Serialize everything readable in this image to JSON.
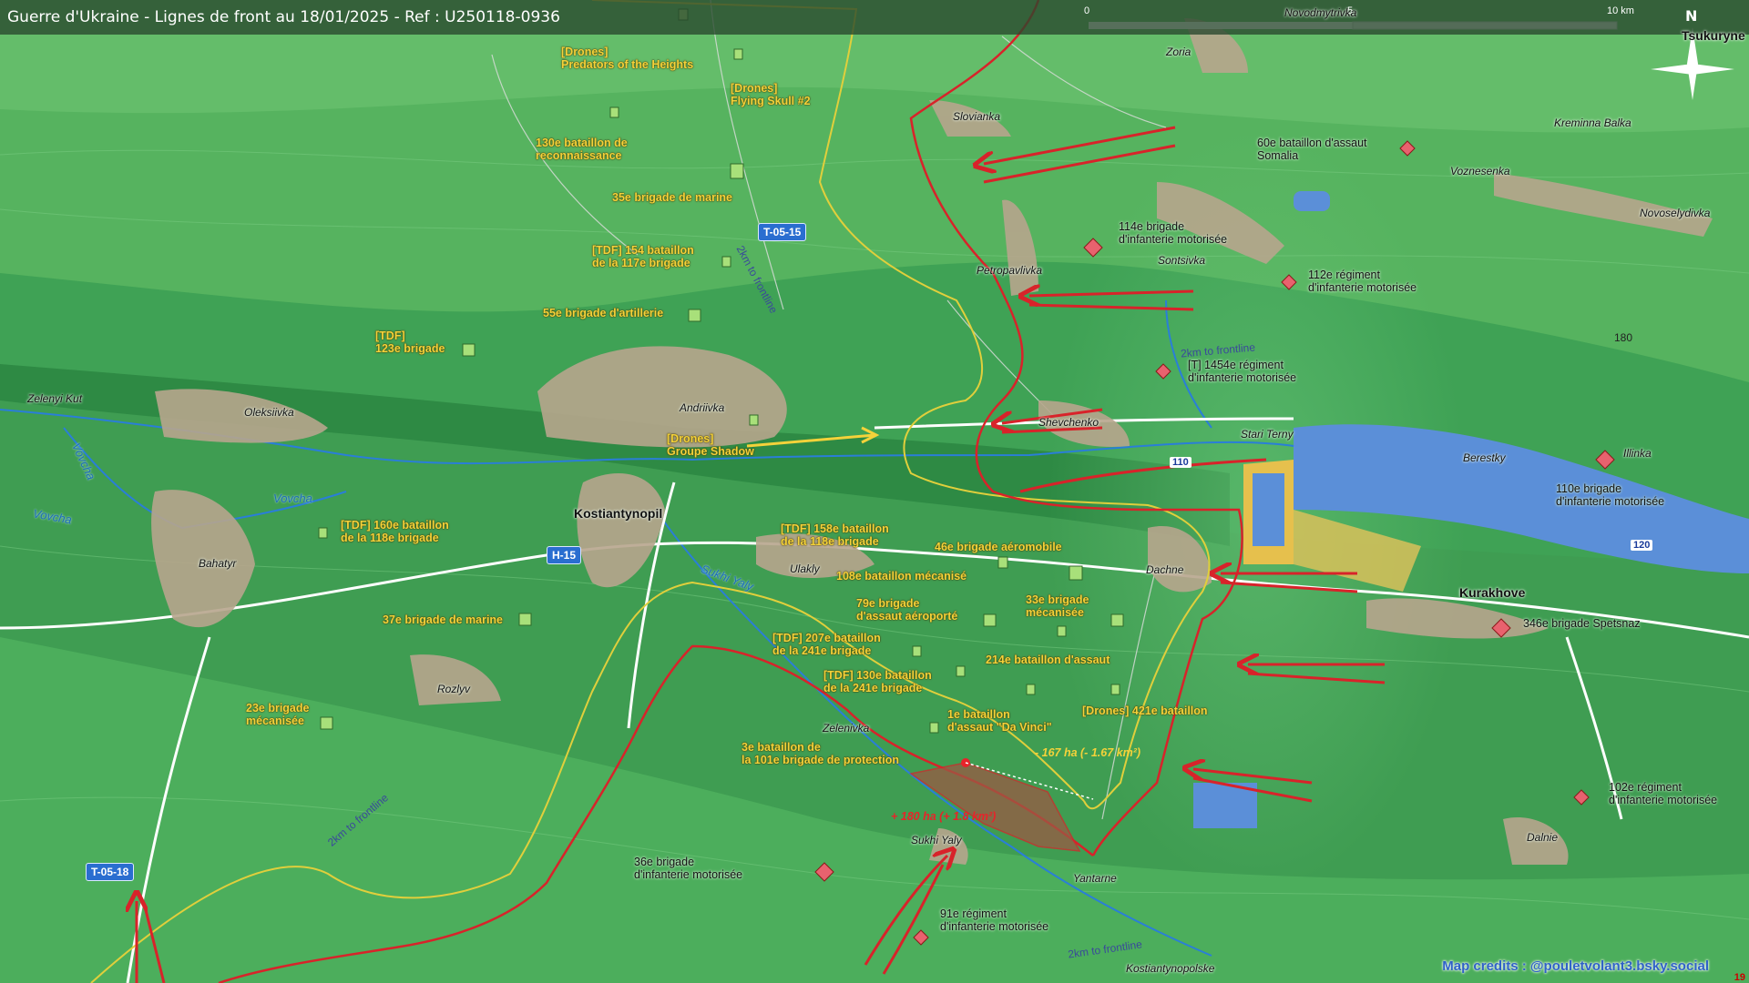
{
  "title": "Guerre d'Ukraine - Lignes de front au 18/01/2025 - Ref : U250118-0936",
  "scale": {
    "zero": "0",
    "five": "5",
    "ten": "10 km"
  },
  "north": "N",
  "credits": "Map credits : @pouletvolant3.bsky.social",
  "corner_number": "19",
  "towns": [
    {
      "name": "Zoria"
    },
    {
      "name": "Slovianka"
    },
    {
      "name": "Petropavlivka"
    },
    {
      "name": "Sontsivka"
    },
    {
      "name": "Kreminna Balka"
    },
    {
      "name": "Voznesenka"
    },
    {
      "name": "Novoselydivka"
    },
    {
      "name": "Zelenyi Kut"
    },
    {
      "name": "Oleksiivka"
    },
    {
      "name": "Andriivka"
    },
    {
      "name": "Shevchenko"
    },
    {
      "name": "Stari Terny"
    },
    {
      "name": "Berestky"
    },
    {
      "name": "Illinka"
    },
    {
      "name": "Kostiantynopil"
    },
    {
      "name": "Ulakly"
    },
    {
      "name": "Dachne"
    },
    {
      "name": "Kurakhove"
    },
    {
      "name": "Bahatyr"
    },
    {
      "name": "Rozlyv"
    },
    {
      "name": "Zelenivka"
    },
    {
      "name": "Sukhi Yaly"
    },
    {
      "name": "Yantarne"
    },
    {
      "name": "Dalnie"
    },
    {
      "name": "Kostiantynopolske"
    },
    {
      "name": "Tsukuryne"
    },
    {
      "name": "Novodmytrivka"
    }
  ],
  "rivers": [
    "Vovcha",
    "Vovcha",
    "Vovcha",
    "Sukhi Yaly"
  ],
  "roads": [
    "T-05-15",
    "H-15",
    "T-05-18"
  ],
  "road_numbers": [
    "110",
    "120"
  ],
  "distance_labels": [
    "2km to frontline",
    "2km to frontline",
    "2km to frontline",
    "2km to frontline"
  ],
  "elevation": "180",
  "ukraine_units": [
    {
      "text": "[Drones]\nPredators of the Heights"
    },
    {
      "text": "[Drones]\nFlying Skull #2"
    },
    {
      "text": "130e bataillon de\nreconnaissance"
    },
    {
      "text": "35e brigade de marine"
    },
    {
      "text": "[TDF] 154 bataillon\nde la 117e brigade"
    },
    {
      "text": "55e brigade d'artillerie"
    },
    {
      "text": "[TDF]\n123e brigade"
    },
    {
      "text": "[Drones]\nGroupe Shadow"
    },
    {
      "text": "[TDF] 160e bataillon\nde la 118e brigade"
    },
    {
      "text": "[TDF] 158e bataillon\nde la 118e brigade"
    },
    {
      "text": "46e brigade aéromobile"
    },
    {
      "text": "108e bataillon mécanisé"
    },
    {
      "text": "79e brigade\nd'assaut aéroporté"
    },
    {
      "text": "33e brigade\nmécanisée"
    },
    {
      "text": "37e brigade de marine"
    },
    {
      "text": "[TDF] 207e bataillon\nde la 241e brigade"
    },
    {
      "text": "214e bataillon d'assaut"
    },
    {
      "text": "[TDF] 130e bataillon\nde la 241e brigade"
    },
    {
      "text": "[Drones] 421e bataillon"
    },
    {
      "text": "23e brigade\nmécanisée"
    },
    {
      "text": "1e bataillon\nd'assaut \"Da Vinci\""
    },
    {
      "text": "3e bataillon de\nla 101e brigade de protection"
    }
  ],
  "russia_units": [
    {
      "text": "60e bataillon d'assaut\nSomalia"
    },
    {
      "text": "114e brigade\nd'infanterie motorisée"
    },
    {
      "text": "112e régiment\nd'infanterie motorisée"
    },
    {
      "text": "[T] 1454e régiment\nd'infanterie motorisée"
    },
    {
      "text": "110e brigade\nd'infanterie motorisée"
    },
    {
      "text": "346e brigade Spetsnaz"
    },
    {
      "text": "102e régiment\nd'infanterie motorisée"
    },
    {
      "text": "36e brigade\nd'infanterie motorisée"
    },
    {
      "text": "91e régiment\nd'infanterie motorisée"
    }
  ],
  "area_changes": [
    {
      "text": "- 167 ha (- 1.67 km²)",
      "color": "#f4d23a"
    },
    {
      "text": "+ 180 ha (+ 1.8 km²)",
      "color": "#e8232a"
    }
  ],
  "colors": {
    "frontline": "#d8232a",
    "ukraine_line": "#d9c23a",
    "ukraine_unit": "#f4d23a",
    "russia_unit": "#e8626e",
    "water": "#5b8fd8"
  }
}
